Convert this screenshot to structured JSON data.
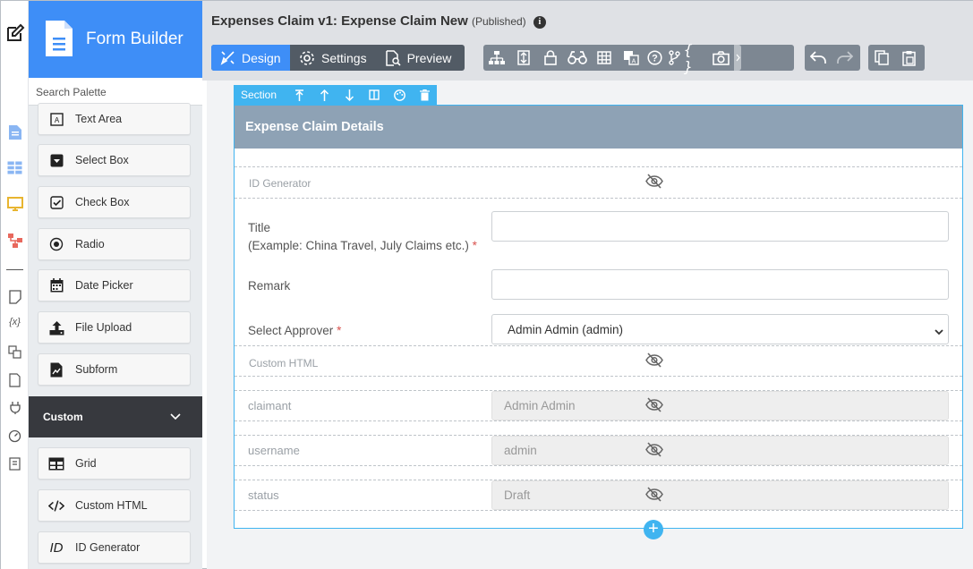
{
  "app": {
    "title": "Form Builder"
  },
  "header": {
    "doc_title": "Expenses Claim v1: Expense Claim New",
    "status": "(Published)"
  },
  "tabs": [
    {
      "label": "Design",
      "icon": "design-icon",
      "active": true
    },
    {
      "label": "Settings",
      "icon": "gear-icon"
    },
    {
      "label": "Preview",
      "icon": "preview-icon"
    }
  ],
  "palette": {
    "search_placeholder": "Search Palette",
    "items": [
      {
        "label": "Text Area",
        "icon": "text-area-icon"
      },
      {
        "label": "Select Box",
        "icon": "select-box-icon"
      },
      {
        "label": "Check Box",
        "icon": "check-box-icon"
      },
      {
        "label": "Radio",
        "icon": "radio-icon"
      },
      {
        "label": "Date Picker",
        "icon": "calendar-icon"
      },
      {
        "label": "File Upload",
        "icon": "upload-icon"
      },
      {
        "label": "Subform",
        "icon": "subform-icon"
      }
    ],
    "category": "Custom",
    "custom_items": [
      {
        "label": "Grid",
        "icon": "grid-icon"
      },
      {
        "label": "Custom HTML",
        "icon": "code-icon"
      },
      {
        "label": "ID Generator",
        "icon": "id-icon",
        "icon_text": "ID"
      }
    ]
  },
  "section": {
    "toolbar_label": "Section",
    "title": "Expense Claim Details",
    "id_generator_label": "ID Generator",
    "title_label": "Title",
    "title_hint": "(Example: China Travel, July Claims etc.)",
    "remark_label": "Remark",
    "approver_label": "Select Approver",
    "approver_value": "Admin Admin (admin)",
    "custom_html_label": "Custom HTML",
    "required_mark": "*",
    "hidden_fields": [
      {
        "label": "claimant",
        "value": "Admin Admin"
      },
      {
        "label": "username",
        "value": "admin"
      },
      {
        "label": "status",
        "value": "Draft"
      }
    ]
  },
  "colors": {
    "brand_blue": "#3e8ef7",
    "section_header": "#8ea2b5",
    "selection_blue": "#40b4f0",
    "dark_category": "#37393e"
  }
}
